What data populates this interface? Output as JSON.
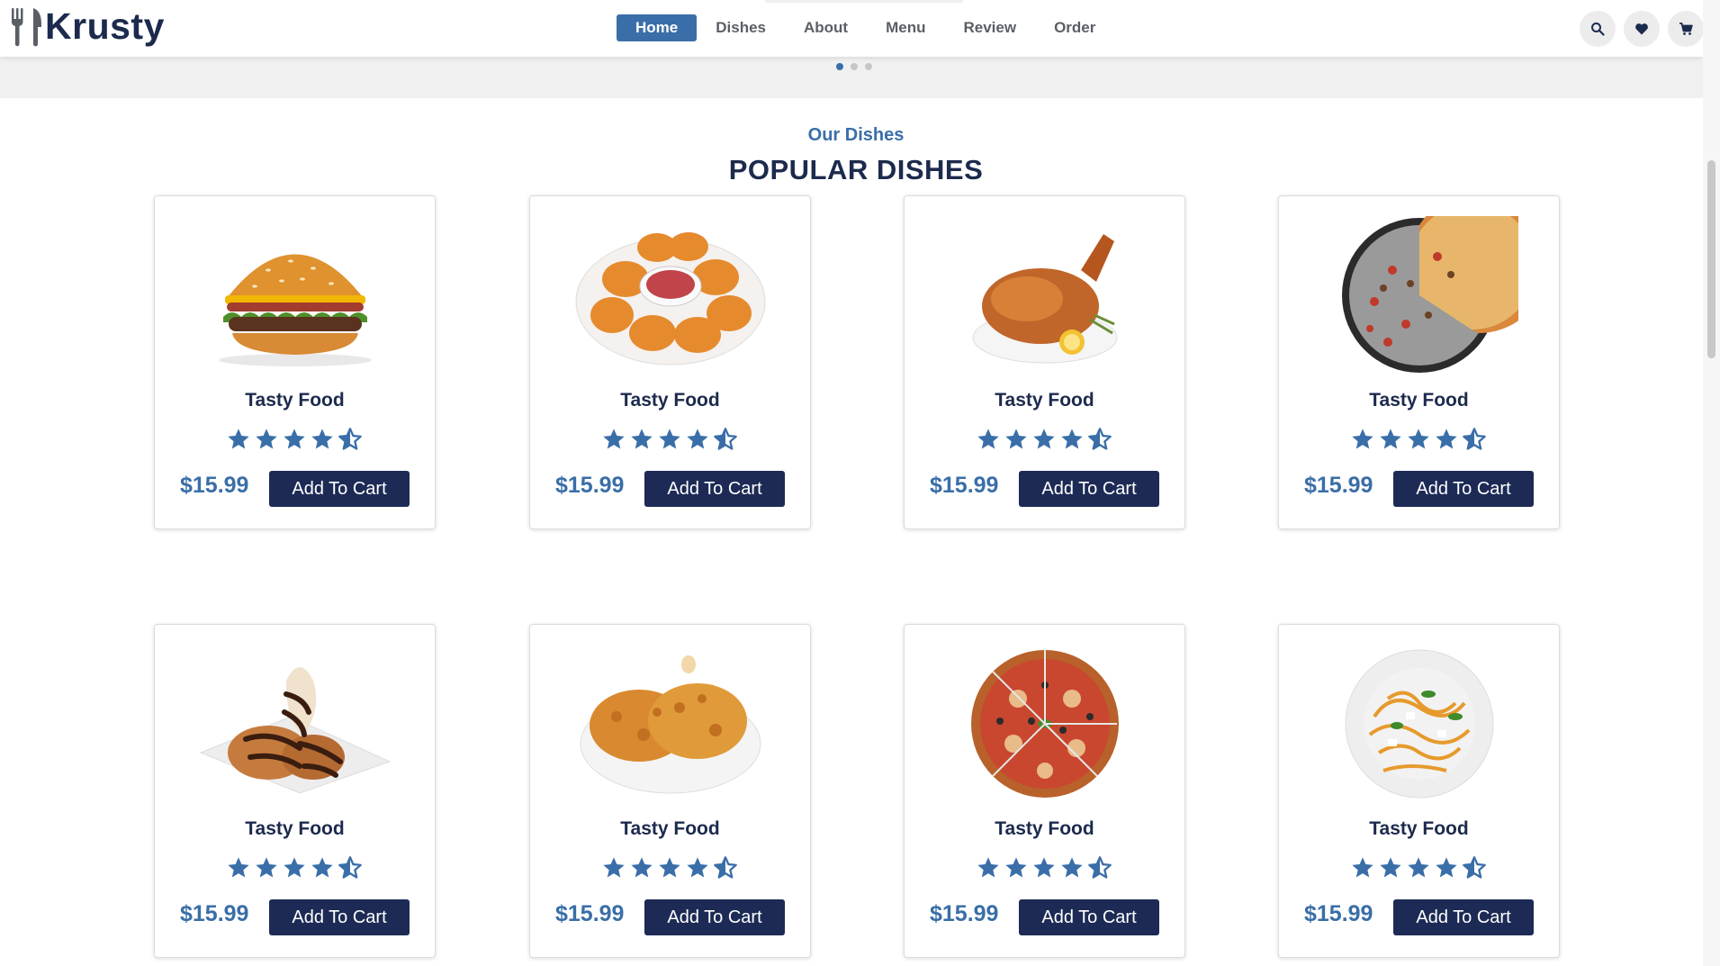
{
  "brand": {
    "name": "Krusty"
  },
  "nav": [
    {
      "label": "Home",
      "active": true
    },
    {
      "label": "Dishes",
      "active": false
    },
    {
      "label": "About",
      "active": false
    },
    {
      "label": "Menu",
      "active": false
    },
    {
      "label": "Review",
      "active": false
    },
    {
      "label": "Order",
      "active": false
    }
  ],
  "header_icons": [
    "search-icon",
    "heart-icon",
    "cart-icon"
  ],
  "slider": {
    "dots": 3,
    "active_index": 0
  },
  "section": {
    "subtitle": "Our Dishes",
    "title": "POPULAR DISHES"
  },
  "colors": {
    "accent": "#3a6ea8",
    "dark": "#1c2a4d",
    "button": "#1c2a55"
  },
  "dishes": [
    {
      "name": "Tasty Food",
      "price": "$15.99",
      "button": "Add To Cart",
      "rating": 4.5,
      "image": "burger"
    },
    {
      "name": "Tasty Food",
      "price": "$15.99",
      "button": "Add To Cart",
      "rating": 4.5,
      "image": "nuggets"
    },
    {
      "name": "Tasty Food",
      "price": "$15.99",
      "button": "Add To Cart",
      "rating": 4.5,
      "image": "roast-chicken"
    },
    {
      "name": "Tasty Food",
      "price": "$15.99",
      "button": "Add To Cart",
      "rating": 4.5,
      "image": "pizza-pan"
    },
    {
      "name": "Tasty Food",
      "price": "$15.99",
      "button": "Add To Cart",
      "rating": 4.5,
      "image": "chocolate-dessert"
    },
    {
      "name": "Tasty Food",
      "price": "$15.99",
      "button": "Add To Cart",
      "rating": 4.5,
      "image": "fried-chicken"
    },
    {
      "name": "Tasty Food",
      "price": "$15.99",
      "button": "Add To Cart",
      "rating": 4.5,
      "image": "pizza"
    },
    {
      "name": "Tasty Food",
      "price": "$15.99",
      "button": "Add To Cart",
      "rating": 4.5,
      "image": "spaghetti"
    }
  ]
}
